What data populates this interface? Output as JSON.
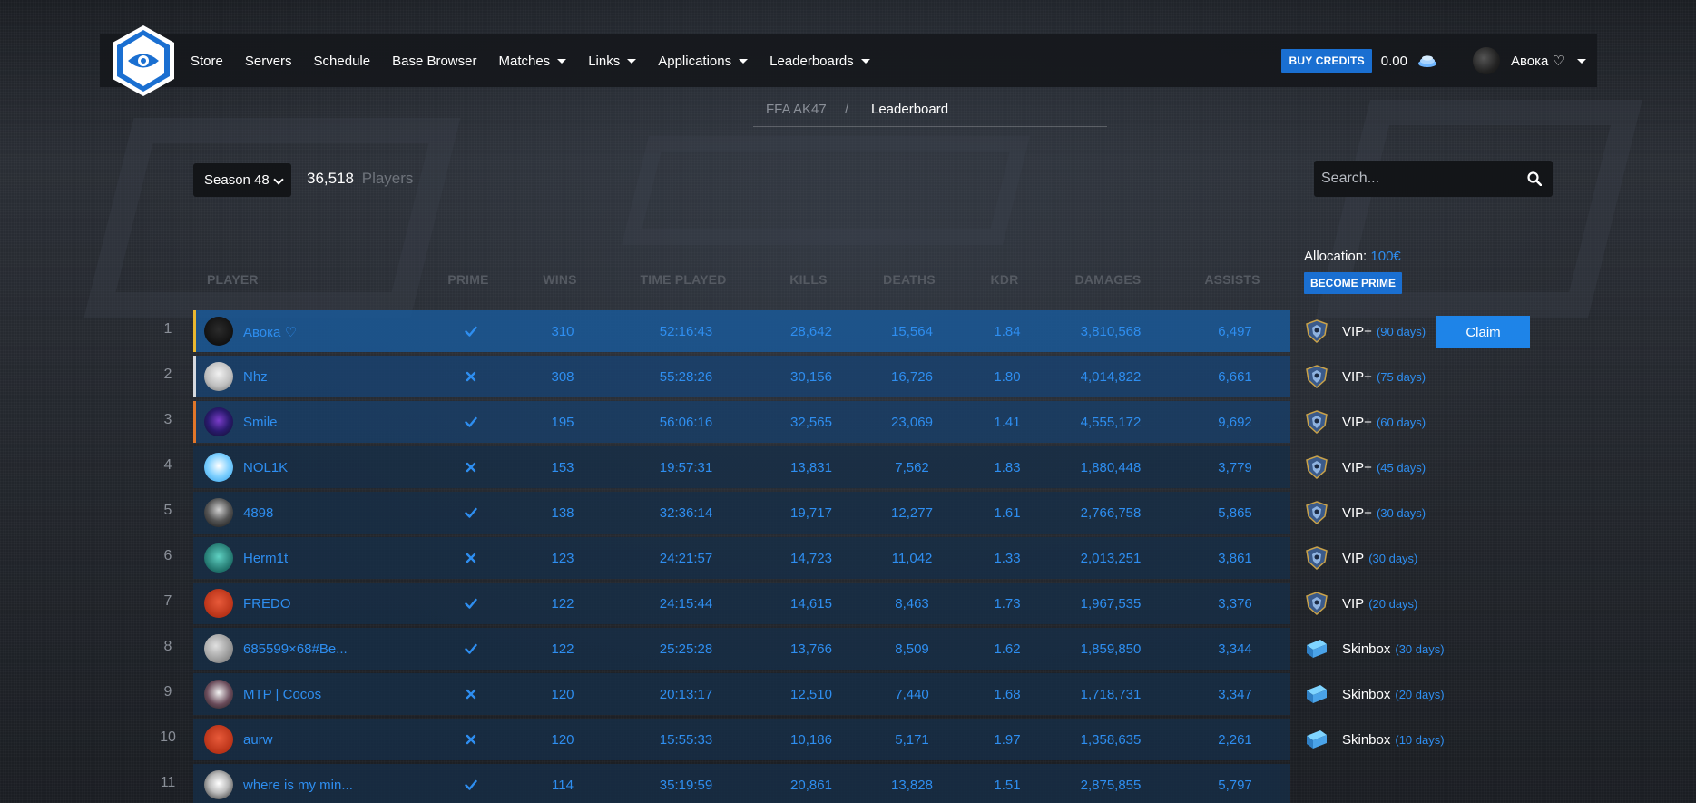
{
  "nav": {
    "items": [
      "Store",
      "Servers",
      "Schedule",
      "Base Browser",
      "Matches",
      "Links",
      "Applications",
      "Leaderboards"
    ],
    "has_caret": [
      false,
      false,
      false,
      false,
      true,
      true,
      true,
      true
    ],
    "buy_label": "BUY CREDITS",
    "credits": "0.00",
    "username": "Авока ♡"
  },
  "breadcrumb": {
    "parent": "FFA AK47",
    "separator": "/",
    "current": "Leaderboard"
  },
  "toolbar": {
    "season": "Season 48",
    "player_count": "36,518",
    "player_label": "Players",
    "search_placeholder": "Search..."
  },
  "table": {
    "headers": [
      "PLAYER",
      "PRIME",
      "WINS",
      "TIME PLAYED",
      "KILLS",
      "DEATHS",
      "KDR",
      "DAMAGES",
      "ASSISTS"
    ],
    "rows": [
      {
        "rank": "1",
        "name": "Авока ♡",
        "prime": true,
        "wins": "310",
        "time": "52:16:43",
        "kills": "28,642",
        "deaths": "15,564",
        "kdr": "1.84",
        "damages": "3,810,568",
        "assists": "6,497"
      },
      {
        "rank": "2",
        "name": "Nhz",
        "prime": false,
        "wins": "308",
        "time": "55:28:26",
        "kills": "30,156",
        "deaths": "16,726",
        "kdr": "1.80",
        "damages": "4,014,822",
        "assists": "6,661"
      },
      {
        "rank": "3",
        "name": "Smile",
        "prime": true,
        "wins": "195",
        "time": "56:06:16",
        "kills": "32,565",
        "deaths": "23,069",
        "kdr": "1.41",
        "damages": "4,555,172",
        "assists": "9,692"
      },
      {
        "rank": "4",
        "name": "NOL1K",
        "prime": false,
        "wins": "153",
        "time": "19:57:31",
        "kills": "13,831",
        "deaths": "7,562",
        "kdr": "1.83",
        "damages": "1,880,448",
        "assists": "3,779"
      },
      {
        "rank": "5",
        "name": "4898",
        "prime": true,
        "wins": "138",
        "time": "32:36:14",
        "kills": "19,717",
        "deaths": "12,277",
        "kdr": "1.61",
        "damages": "2,766,758",
        "assists": "5,865"
      },
      {
        "rank": "6",
        "name": "Herm1t",
        "prime": false,
        "wins": "123",
        "time": "24:21:57",
        "kills": "14,723",
        "deaths": "11,042",
        "kdr": "1.33",
        "damages": "2,013,251",
        "assists": "3,861"
      },
      {
        "rank": "7",
        "name": "FREDO",
        "prime": true,
        "wins": "122",
        "time": "24:15:44",
        "kills": "14,615",
        "deaths": "8,463",
        "kdr": "1.73",
        "damages": "1,967,535",
        "assists": "3,376"
      },
      {
        "rank": "8",
        "name": "685599×68#Be...",
        "prime": true,
        "wins": "122",
        "time": "25:25:28",
        "kills": "13,766",
        "deaths": "8,509",
        "kdr": "1.62",
        "damages": "1,859,850",
        "assists": "3,344"
      },
      {
        "rank": "9",
        "name": "MTP | Cocos",
        "prime": false,
        "wins": "120",
        "time": "20:13:17",
        "kills": "12,510",
        "deaths": "7,440",
        "kdr": "1.68",
        "damages": "1,718,731",
        "assists": "3,347"
      },
      {
        "rank": "10",
        "name": "aurw",
        "prime": false,
        "wins": "120",
        "time": "15:55:33",
        "kills": "10,186",
        "deaths": "5,171",
        "kdr": "1.97",
        "damages": "1,358,635",
        "assists": "2,261"
      },
      {
        "rank": "11",
        "name": "where is my min...",
        "prime": true,
        "wins": "114",
        "time": "35:19:59",
        "kills": "20,861",
        "deaths": "13,828",
        "kdr": "1.51",
        "damages": "2,875,855",
        "assists": "5,797"
      }
    ]
  },
  "sidebar": {
    "allocation_label": "Allocation:",
    "allocation_value": "100€",
    "become_prime": "BECOME PRIME",
    "claim": "Claim",
    "rewards": [
      {
        "name": "VIP+",
        "days": "(90 days)",
        "icon": "vip-shield-icon"
      },
      {
        "name": "VIP+",
        "days": "(75 days)",
        "icon": "vip-shield-icon"
      },
      {
        "name": "VIP+",
        "days": "(60 days)",
        "icon": "vip-shield-icon"
      },
      {
        "name": "VIP+",
        "days": "(45 days)",
        "icon": "vip-shield-icon"
      },
      {
        "name": "VIP+",
        "days": "(30 days)",
        "icon": "vip-shield-icon"
      },
      {
        "name": "VIP",
        "days": "(30 days)",
        "icon": "vip-shield-icon"
      },
      {
        "name": "VIP",
        "days": "(20 days)",
        "icon": "vip-shield-icon"
      },
      {
        "name": "Skinbox",
        "days": "(30 days)",
        "icon": "skinbox-icon"
      },
      {
        "name": "Skinbox",
        "days": "(20 days)",
        "icon": "skinbox-icon"
      },
      {
        "name": "Skinbox",
        "days": "(10 days)",
        "icon": "skinbox-icon"
      }
    ]
  },
  "colors": {
    "accent": "#1a6fd1",
    "link": "#2e8ef0",
    "gold": "#e8b730",
    "silver": "#d6d9de",
    "bronze": "#e0762a"
  }
}
